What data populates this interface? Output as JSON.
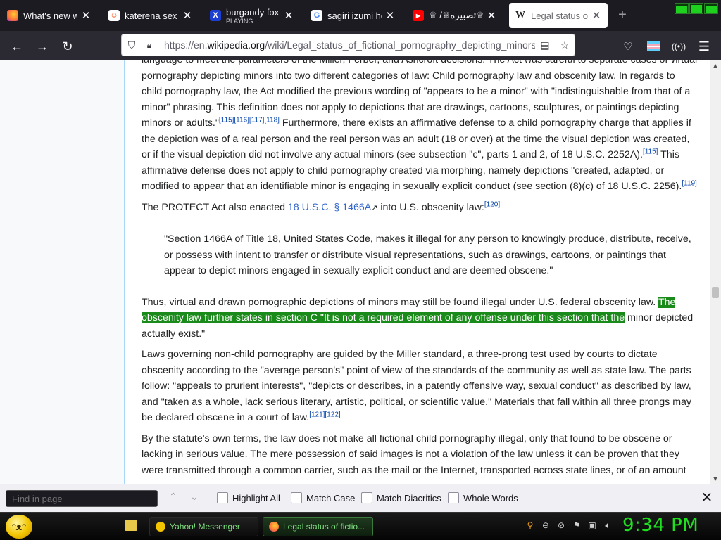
{
  "tabs": [
    {
      "title": "What's new with",
      "favicon_color": "#ff7139",
      "favicon_glyph": "firefox-icon",
      "active": false
    },
    {
      "title": "katerena sex (RE",
      "favicon_color": "#ffffff",
      "favicon_glyph": "reddit-icon",
      "active": false
    },
    {
      "title": "burgandy fox thi",
      "subtitle": "PLAYING",
      "favicon_color": "#1d3fd1",
      "favicon_glyph": "x-icon",
      "active": false
    },
    {
      "title": "sagiri izumi hent",
      "favicon_color": "#ffffff",
      "favicon_glyph": "google-icon",
      "active": false
    },
    {
      "title": "♕ /♕تصبيره♕",
      "favicon_color": "#ff0000",
      "favicon_glyph": "youtube-icon",
      "active": false
    },
    {
      "title": "Legal status of f",
      "favicon_color": "#ffffff",
      "favicon_glyph": "wikipedia-icon",
      "active": true
    }
  ],
  "urlbar": {
    "url_prefix": "https://en.",
    "url_domain": "wikipedia.org",
    "url_path": "/wiki/Legal_status_of_fictional_pornography_depicting_minors"
  },
  "article": {
    "p1": {
      "t1": "language to meet the parameters of the Miller, Ferber, and Ashcroft decisions. The Act was careful to separate cases of virtual pornography depicting minors into two different categories of law: Child pornography law and obscenity law. In regards to child pornography law, the Act modified the previous wording of \"appears to be a minor\" with \"indistinguishable from that of a minor\" phrasing. This definition does not apply to depictions that are drawings, cartoons, sculptures, or paintings depicting minors or adults.\"",
      "ref1": "[115][116][117][118]",
      "t2": " Furthermore, there exists an affirmative defense to a child pornography charge that applies if the depiction was of a real person and the real person was an adult (18 or over) at the time the visual depiction was created, or if the visual depiction did not involve any actual minors (see subsection \"c\", parts 1 and 2, of 18 U.S.C. 2252A).",
      "ref2": "[115]",
      "t3": " This affirmative defense does not apply to child pornography created via morphing, namely depictions \"created, adapted, or modified to appear that an identifiable minor is engaging in sexually explicit conduct (see section (8)(c) of 18 U.S.C. 2256).",
      "ref3": "[119]"
    },
    "p2": {
      "t1": "The PROTECT Act also enacted ",
      "link": "18 U.S.C. § 1466A",
      "t2": " into U.S. obscenity law:",
      "ref1": "[120]"
    },
    "quote": "\"Section 1466A of Title 18, United States Code, makes it illegal for any person to knowingly produce, distribute, receive, or possess with intent to transfer or distribute visual representations, such as drawings, cartoons, or paintings that appear to depict minors engaged in sexually explicit conduct and are deemed obscene.\"",
    "p3": {
      "t1": "Thus, virtual and drawn pornographic depictions of minors may still be found illegal under U.S. federal obscenity law. ",
      "highlight": "The obscenity law further states in section C \"It is not a required element of any offense under this section that the",
      "t2": " minor depicted actually exist.\""
    },
    "p4": {
      "t1": "Laws governing non-child pornography are guided by the Miller standard, a three-prong test used by courts to dictate obscenity according to the \"average person's\" point of view of the standards of the community as well as state law. The parts follow: \"appeals to prurient interests\", \"depicts or describes, in a patently offensive way, sexual conduct\" as described by law, and \"taken as a whole, lack serious literary, artistic, political, or scientific value.\" Materials that fall within all three prongs may be declared obscene in a court of law.",
      "ref1": "[121][122]"
    },
    "p5": {
      "t1": "By the statute's own terms, the law does not make all fictional child pornography illegal, only that found to be obscene or lacking in serious value. The mere possession of said images is not a violation of the law unless it can be proven that they were transmitted through a common carrier, such as the mail or the Internet, transported across state lines, or of an amount"
    }
  },
  "findbar": {
    "placeholder": "Find in page",
    "highlight_all": "Highlight All",
    "match_case": "Match Case",
    "match_diacritics": "Match Diacritics",
    "whole_words": "Whole Words"
  },
  "taskbar": {
    "buttons": [
      {
        "label": "Yahoo! Messenger",
        "active": false
      },
      {
        "label": "Legal status of fictio...",
        "active": true
      }
    ],
    "clock": "9:34 PM"
  },
  "colors": {
    "highlight": "#1a8a1a",
    "link": "#3366cc",
    "clock": "#1fe01f"
  }
}
